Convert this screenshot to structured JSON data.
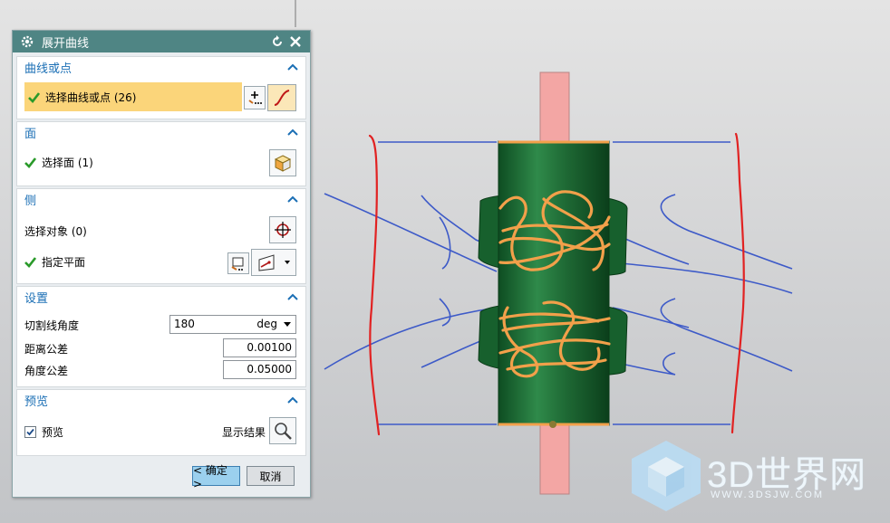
{
  "dialog": {
    "title": "展开曲线",
    "sections": {
      "curve": {
        "header": "曲线或点",
        "select_label": "选择曲线或点 (26)"
      },
      "face": {
        "header": "面",
        "select_label": "选择面 (1)"
      },
      "side": {
        "header": "侧",
        "select_label": "选择对象 (0)",
        "plane_label": "指定平面"
      },
      "settings": {
        "header": "设置",
        "cut_angle_label": "切割线角度",
        "cut_angle_value": "180",
        "cut_angle_unit": "deg",
        "dist_tol_label": "距离公差",
        "dist_tol_value": "0.00100",
        "angle_tol_label": "角度公差",
        "angle_tol_value": "0.05000"
      },
      "preview": {
        "header": "预览",
        "preview_label": "预览",
        "preview_checked": true,
        "show_result_label": "显示结果"
      }
    },
    "ok_label": "< 确定 >",
    "cancel_label": "取消"
  },
  "watermark": {
    "brand": "3D世界网",
    "url": "WWW.3DSJW.COM"
  },
  "colors": {
    "title_bar": "#4f8584",
    "highlight": "#fbd57a",
    "section_header": "#1b6fb5",
    "cylinder": "#1f6a35",
    "shaft": "#f3a6a4",
    "curve_orange": "#f2a04a",
    "curve_blue": "#3d5ac8",
    "markup_red": "#e12222"
  }
}
